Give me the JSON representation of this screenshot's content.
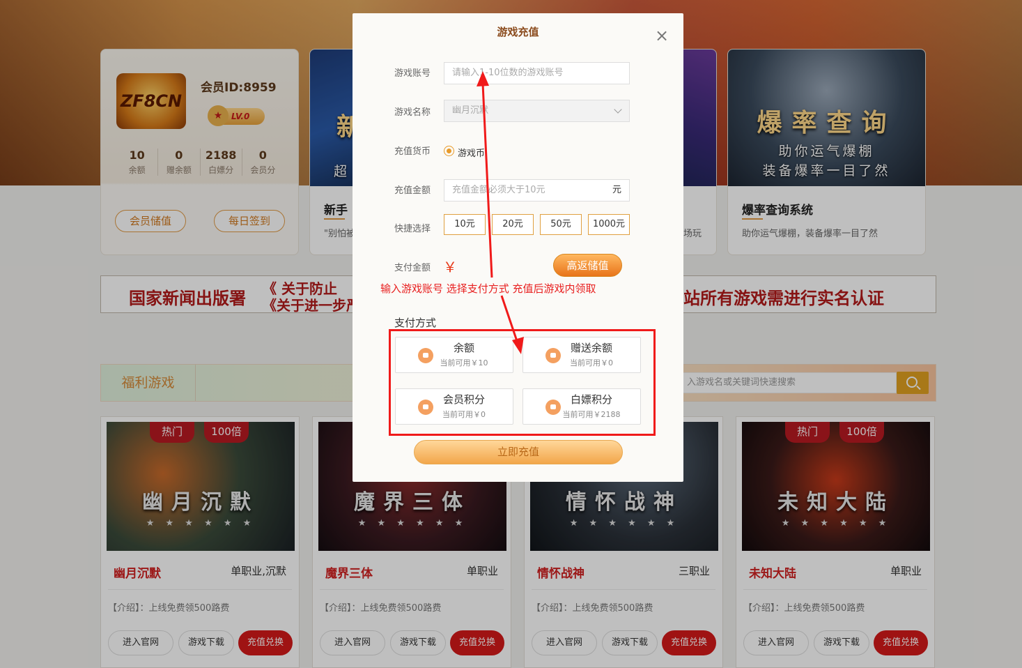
{
  "member": {
    "logo_text": "ZF8CN",
    "id_label": "会员ID:8959",
    "level": "LV.0",
    "stats": [
      {
        "value": "10",
        "label": "余额"
      },
      {
        "value": "0",
        "label": "赠余额"
      },
      {
        "value": "2188",
        "label": "白嫖分"
      },
      {
        "value": "0",
        "label": "会员分"
      }
    ],
    "recharge_button": "会员储值",
    "signin_button": "每日签到"
  },
  "promos": [
    {
      "banner": "新",
      "banner_sub": "超",
      "title": "新手",
      "desc": "\"别怕被"
    },
    {
      "banner": "",
      "banner_sub": "",
      "title": "",
      "desc": "场玩"
    },
    {
      "banner": "爆率查询",
      "banner_sub": "助你运气爆棚\n装备爆率一目了然",
      "title": "爆率查询系统",
      "desc": "助你运气爆棚，装备爆率一目了然"
    }
  ],
  "notice": {
    "left": "国家新闻出版署",
    "middle_top": "《 关于防止",
    "middle_bottom": "《关于进一步严",
    "right": "站所有游戏需进行实名认证"
  },
  "welfare": {
    "tab": "福利游戏",
    "search_placeholder": "入游戏名或关键词快速搜索"
  },
  "games": [
    {
      "cover_title": "幽月沉默",
      "name": "幽月沉默",
      "type": "单职业,沉默",
      "intro": "【介绍】：上线免费领500路费",
      "ribbons": [
        "热门",
        "100倍"
      ]
    },
    {
      "cover_title": "魔界三体",
      "name": "魔界三体",
      "type": "单职业",
      "intro": "【介绍】：上线免费领500路费",
      "ribbons": []
    },
    {
      "cover_title": "情怀战神",
      "name": "情怀战神",
      "type": "三职业",
      "intro": "【介绍】：上线免费领500路费",
      "ribbons": []
    },
    {
      "cover_title": "未知大陆",
      "name": "未知大陆",
      "type": "单职业",
      "intro": "【介绍】：上线免费领500路费",
      "ribbons": [
        "热门",
        "100倍"
      ]
    }
  ],
  "game_buttons": {
    "site": "进入官网",
    "download": "游戏下载",
    "recharge": "充值兑换"
  },
  "cover_stars": "★ ★ ★ ★ ★ ★",
  "modal": {
    "title": "游戏充值",
    "close": "×",
    "account_label": "游戏账号",
    "account_placeholder": "请输入1-10位数的游戏账号",
    "game_label": "游戏名称",
    "game_value": "幽月沉默",
    "currency_label": "充值货币",
    "currency_option": "游戏币",
    "amount_label": "充值金额",
    "amount_placeholder": "充值金额必须大于10元",
    "amount_unit": "元",
    "quick_label": "快捷选择",
    "quick_options": [
      "10元",
      "20元",
      "50元",
      "1000元"
    ],
    "pay_amount_label": "支付金额",
    "currency_symbol": "￥",
    "high_return_button": "高返储值",
    "annotation": "输入游戏账号  选择支付方式  充值后游戏内领取",
    "pay_method_title": "支付方式",
    "pay_methods": [
      {
        "name": "余额",
        "available": "当前可用￥10"
      },
      {
        "name": "赠送余额",
        "available": "当前可用￥0"
      },
      {
        "name": "会员积分",
        "available": "当前可用￥0"
      },
      {
        "name": "白嫖积分",
        "available": "当前可用￥2188"
      }
    ],
    "submit_button": "立即充值"
  },
  "colors": {
    "accent": "#e8741a",
    "brand_red": "#d41a1a",
    "annotation_red": "#f01a1a",
    "title_brown": "#8a4a1c"
  }
}
